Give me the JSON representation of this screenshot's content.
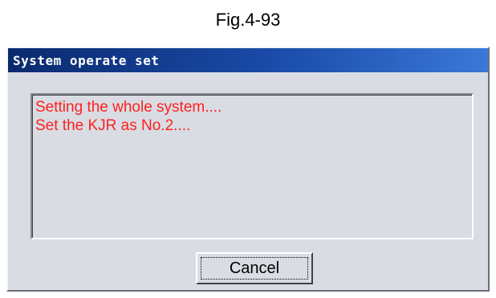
{
  "figure": {
    "caption": "Fig.4-93"
  },
  "dialog": {
    "title": "System operate set",
    "messages": [
      "Setting the whole system....",
      "Set the KJR as No.2...."
    ],
    "cancel_label": "Cancel"
  },
  "colors": {
    "title_bar": "#1a4ba8",
    "message_text": "#ff2020",
    "dialog_bg": "#d9dde3"
  }
}
